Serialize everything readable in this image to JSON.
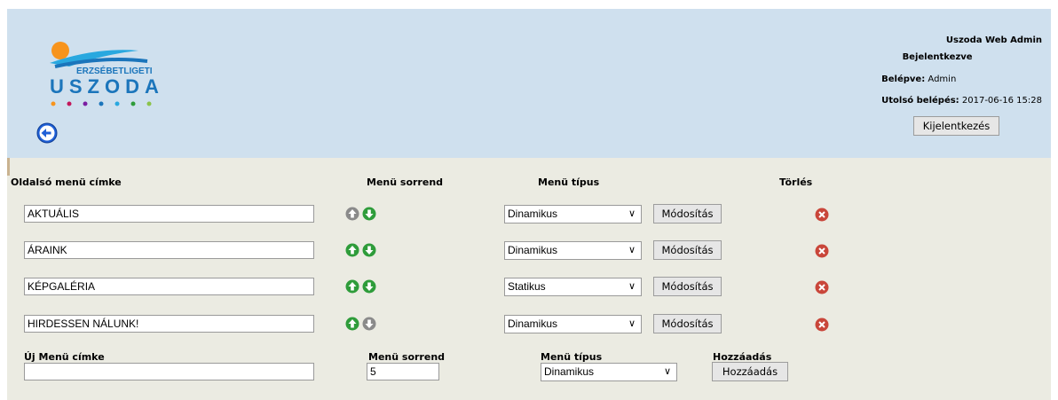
{
  "brand": {
    "logo_line1": "ERZSÉBETLIGETI",
    "logo_line2": "USZODA"
  },
  "user": {
    "app_title": "Uszoda Web Admin",
    "status": "Bejelentkezve",
    "login_label": "Belépve:",
    "login_value": "Admin",
    "last_login_label": "Utolsó belépés:",
    "last_login_value": "2017-06-16 15:28",
    "logout_label": "Kijelentkezés"
  },
  "columns": {
    "label": "Oldalsó menü címke",
    "order": "Menü sorrend",
    "type": "Menü típus",
    "delete": "Törlés"
  },
  "rows": [
    {
      "label": "AKTUÁLIS",
      "type": "Dinamikus",
      "modify": "Módosítás"
    },
    {
      "label": "ÁRAINK",
      "type": "Dinamikus",
      "modify": "Módosítás"
    },
    {
      "label": "KÉPGALÉRIA",
      "type": "Statikus",
      "modify": "Módosítás"
    },
    {
      "label": "HIRDESSEN NÁLUNK!",
      "type": "Dinamikus",
      "modify": "Módosítás"
    }
  ],
  "new_item": {
    "label_header": "Új Menü címke",
    "label_value": "",
    "order_header": "Menü sorrend",
    "order_value": "5",
    "type_header": "Menü típus",
    "type_value": "Dinamikus",
    "add_header": "Hozzáadás",
    "add_button": "Hozzáadás"
  },
  "colors": {
    "header_bg": "#cfe0ee",
    "content_bg": "#ebebe2",
    "up_green": "#2e9c3a",
    "disabled_gray": "#8a8a8a",
    "delete_red": "#c9463a"
  }
}
